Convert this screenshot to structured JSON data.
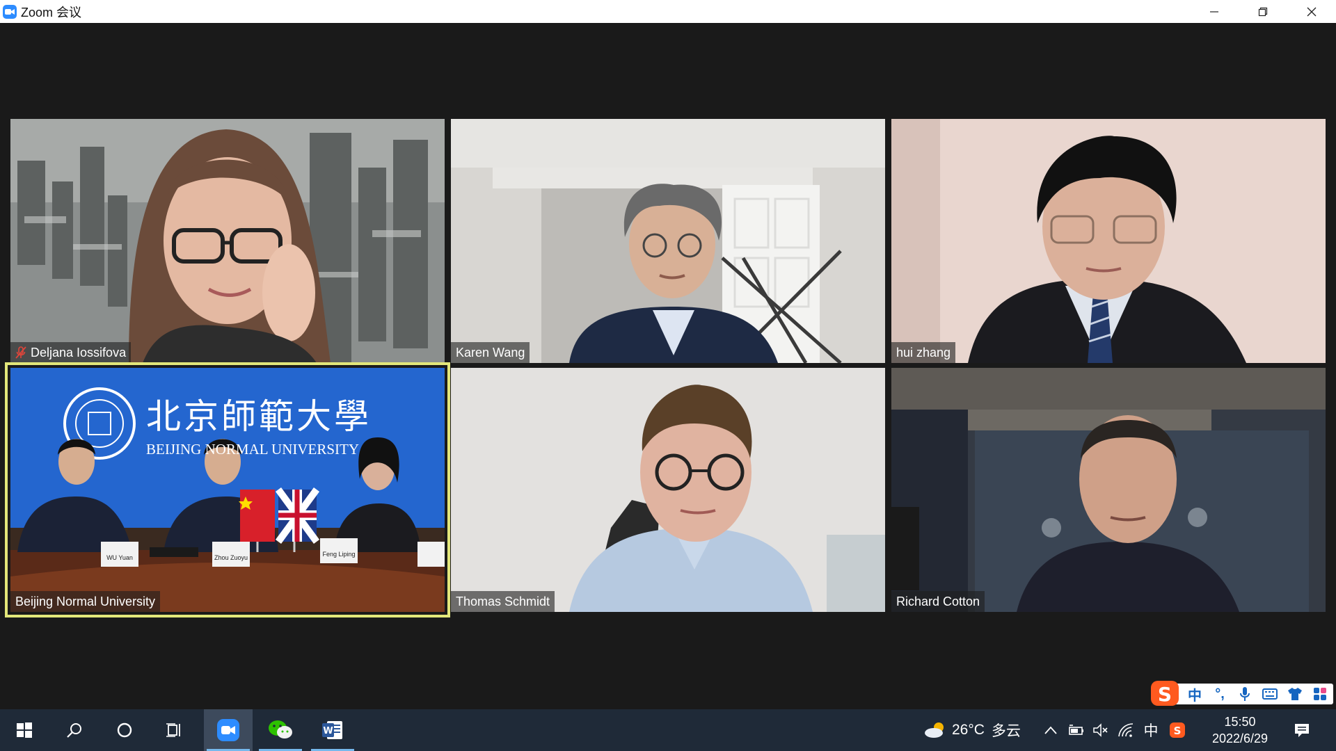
{
  "window": {
    "title": "Zoom 会议",
    "controls": [
      "minimize",
      "restore",
      "close"
    ]
  },
  "meeting": {
    "participants": [
      {
        "name": "Deljana Iossifova",
        "muted": true,
        "active_speaker": false
      },
      {
        "name": "Karen Wang",
        "muted": false,
        "active_speaker": false
      },
      {
        "name": "hui zhang",
        "muted": false,
        "active_speaker": false
      },
      {
        "name": "Beijing Normal University",
        "muted": false,
        "active_speaker": true
      },
      {
        "name": "Thomas Schmidt",
        "muted": false,
        "active_speaker": false
      },
      {
        "name": "Richard Cotton",
        "muted": false,
        "active_speaker": false
      }
    ],
    "bnu_banner": {
      "chinese": "北京師範大學",
      "english": "BEIJING NORMAL UNIVERSITY",
      "nameplates": [
        "WU Yuan",
        "Zhou Zuoyu",
        "Feng Liping"
      ]
    },
    "active_border_color": "#e3e77a"
  },
  "ime": {
    "logo": "S",
    "mode": "中",
    "punct": "°,",
    "icons": [
      "microphone-icon",
      "keyboard-icon",
      "shirt-icon",
      "grid-icon"
    ]
  },
  "taskbar": {
    "apps": [
      "start-icon",
      "search-icon",
      "cortana-icon",
      "task-view-icon",
      "zoom-icon",
      "wechat-icon",
      "word-icon"
    ],
    "weather": {
      "temp": "26°C",
      "condition": "多云"
    },
    "ime_mode": "中",
    "time": "15:50",
    "date": "2022/6/29"
  }
}
